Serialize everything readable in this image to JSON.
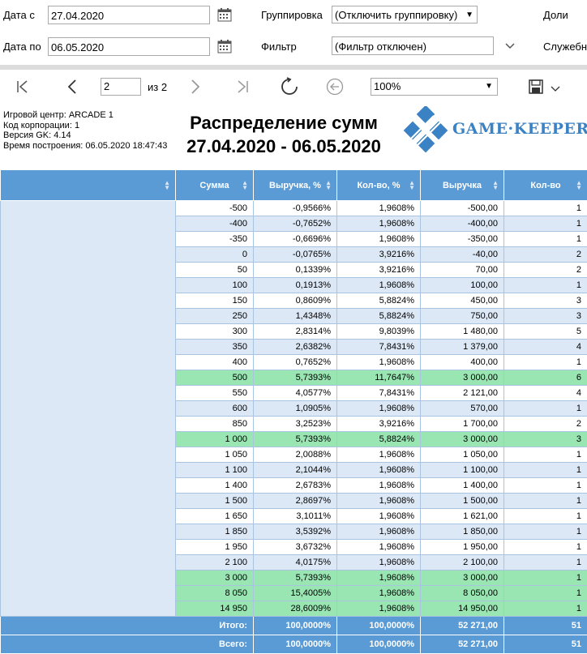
{
  "params": {
    "date_from_label": "Дата с",
    "date_from_value": "27.04.2020",
    "date_to_label": "Дата по",
    "date_to_value": "06.05.2020",
    "grouping_label": "Группировка",
    "grouping_value": "(Отключить группировку)",
    "filter_label": "Фильтр",
    "filter_value": "(Фильтр отключен)",
    "right_label_1": "Доли",
    "right_label_2": "Служебн"
  },
  "toolbar": {
    "page_current": "2",
    "page_of": "из 2",
    "zoom": "100%"
  },
  "report": {
    "info": [
      "Игровой центр: ARCADE 1",
      "Код корпорации: 1",
      "Версия GK: 4.14",
      "Время построения: 06.05.2020 18:47:43"
    ],
    "title": "Распределение сумм",
    "period": "27.04.2020 - 06.05.2020",
    "logo_text": "GAME·KEEPER",
    "brand_color": "#3b82c4"
  },
  "table": {
    "headers": [
      "Сумма",
      "Выручка, %",
      "Кол-во, %",
      "Выручка",
      "Кол-во"
    ],
    "rows": [
      [
        "-500",
        "-0,9566%",
        "1,9608%",
        "-500,00",
        "1",
        0
      ],
      [
        "-400",
        "-0,7652%",
        "1,9608%",
        "-400,00",
        "1",
        0
      ],
      [
        "-350",
        "-0,6696%",
        "1,9608%",
        "-350,00",
        "1",
        0
      ],
      [
        "0",
        "-0,0765%",
        "3,9216%",
        "-40,00",
        "2",
        0
      ],
      [
        "50",
        "0,1339%",
        "3,9216%",
        "70,00",
        "2",
        0
      ],
      [
        "100",
        "0,1913%",
        "1,9608%",
        "100,00",
        "1",
        0
      ],
      [
        "150",
        "0,8609%",
        "5,8824%",
        "450,00",
        "3",
        0
      ],
      [
        "250",
        "1,4348%",
        "5,8824%",
        "750,00",
        "3",
        0
      ],
      [
        "300",
        "2,8314%",
        "9,8039%",
        "1 480,00",
        "5",
        0
      ],
      [
        "350",
        "2,6382%",
        "7,8431%",
        "1 379,00",
        "4",
        0
      ],
      [
        "400",
        "0,7652%",
        "1,9608%",
        "400,00",
        "1",
        0
      ],
      [
        "500",
        "5,7393%",
        "11,7647%",
        "3 000,00",
        "6",
        1
      ],
      [
        "550",
        "4,0577%",
        "7,8431%",
        "2 121,00",
        "4",
        0
      ],
      [
        "600",
        "1,0905%",
        "1,9608%",
        "570,00",
        "1",
        0
      ],
      [
        "850",
        "3,2523%",
        "3,9216%",
        "1 700,00",
        "2",
        0
      ],
      [
        "1 000",
        "5,7393%",
        "5,8824%",
        "3 000,00",
        "3",
        1
      ],
      [
        "1 050",
        "2,0088%",
        "1,9608%",
        "1 050,00",
        "1",
        0
      ],
      [
        "1 100",
        "2,1044%",
        "1,9608%",
        "1 100,00",
        "1",
        0
      ],
      [
        "1 400",
        "2,6783%",
        "1,9608%",
        "1 400,00",
        "1",
        0
      ],
      [
        "1 500",
        "2,8697%",
        "1,9608%",
        "1 500,00",
        "1",
        0
      ],
      [
        "1 650",
        "3,1011%",
        "1,9608%",
        "1 621,00",
        "1",
        0
      ],
      [
        "1 850",
        "3,5392%",
        "1,9608%",
        "1 850,00",
        "1",
        0
      ],
      [
        "1 950",
        "3,6732%",
        "1,9608%",
        "1 950,00",
        "1",
        0
      ],
      [
        "2 100",
        "4,0175%",
        "1,9608%",
        "2 100,00",
        "1",
        0
      ],
      [
        "3 000",
        "5,7393%",
        "1,9608%",
        "3 000,00",
        "1",
        1
      ],
      [
        "8 050",
        "15,4005%",
        "1,9608%",
        "8 050,00",
        "1",
        1
      ],
      [
        "14 950",
        "28,6009%",
        "1,9608%",
        "14 950,00",
        "1",
        1
      ]
    ],
    "totals": [
      [
        "Итого:",
        "100,0000%",
        "100,0000%",
        "52 271,00",
        "51"
      ],
      [
        "Всего:",
        "100,0000%",
        "100,0000%",
        "52 271,00",
        "51"
      ]
    ]
  }
}
